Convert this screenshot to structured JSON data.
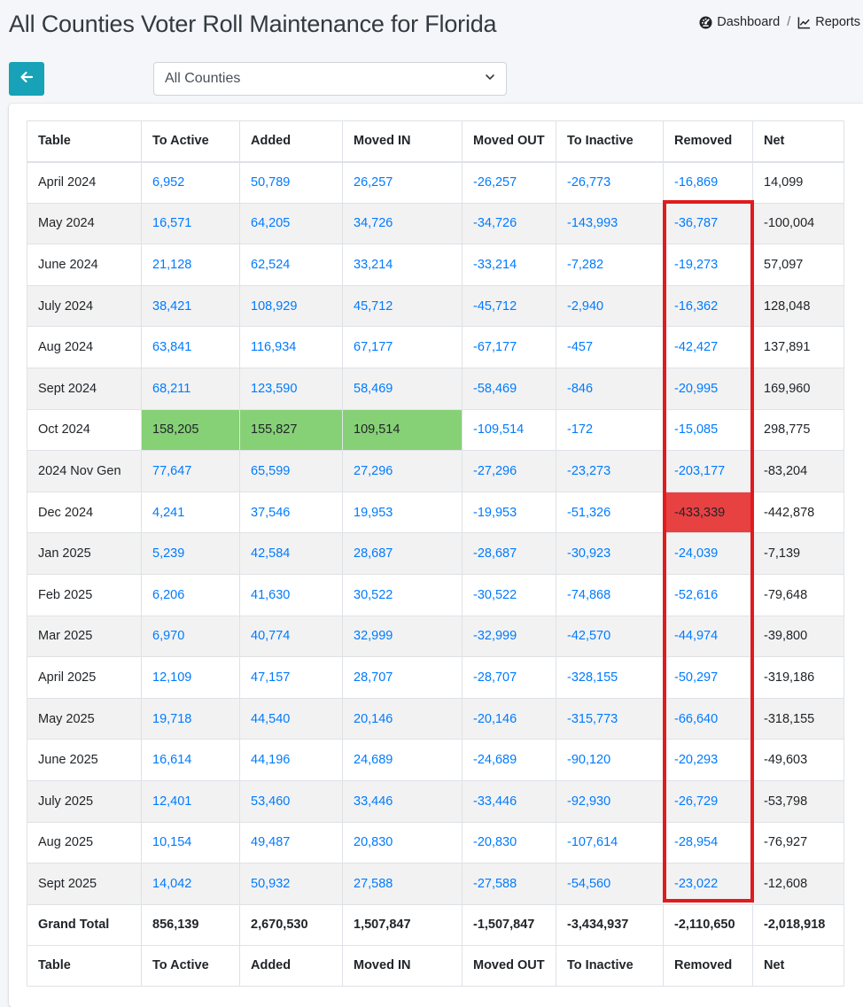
{
  "header": {
    "title": "All Counties Voter Roll Maintenance for Florida",
    "breadcrumb": {
      "dashboard": "Dashboard",
      "separator": "/",
      "reports": "Reports"
    }
  },
  "toolbar": {
    "back_icon": "arrow-left-icon",
    "county_select": {
      "selected": "All Counties"
    }
  },
  "colors": {
    "accent": "#17a2b8",
    "link": "#007bff",
    "highlight_green": "#86d175",
    "highlight_red": "#e84142",
    "annotation_box": "#e11b1d"
  },
  "table": {
    "columns": [
      "Table",
      "To Active",
      "Added",
      "Moved IN",
      "Moved OUT",
      "To Inactive",
      "Removed",
      "Net"
    ],
    "rows": [
      [
        "April 2024",
        "6,952",
        "50,789",
        "26,257",
        "-26,257",
        "-26,773",
        "-16,869",
        "14,099"
      ],
      [
        "May 2024",
        "16,571",
        "64,205",
        "34,726",
        "-34,726",
        "-143,993",
        "-36,787",
        "-100,004"
      ],
      [
        "June 2024",
        "21,128",
        "62,524",
        "33,214",
        "-33,214",
        "-7,282",
        "-19,273",
        "57,097"
      ],
      [
        "July 2024",
        "38,421",
        "108,929",
        "45,712",
        "-45,712",
        "-2,940",
        "-16,362",
        "128,048"
      ],
      [
        "Aug 2024",
        "63,841",
        "116,934",
        "67,177",
        "-67,177",
        "-457",
        "-42,427",
        "137,891"
      ],
      [
        "Sept 2024",
        "68,211",
        "123,590",
        "58,469",
        "-58,469",
        "-846",
        "-20,995",
        "169,960"
      ],
      [
        "Oct 2024",
        "158,205",
        "155,827",
        "109,514",
        "-109,514",
        "-172",
        "-15,085",
        "298,775"
      ],
      [
        "2024 Nov Gen",
        "77,647",
        "65,599",
        "27,296",
        "-27,296",
        "-23,273",
        "-203,177",
        "-83,204"
      ],
      [
        "Dec 2024",
        "4,241",
        "37,546",
        "19,953",
        "-19,953",
        "-51,326",
        "-433,339",
        "-442,878"
      ],
      [
        "Jan 2025",
        "5,239",
        "42,584",
        "28,687",
        "-28,687",
        "-30,923",
        "-24,039",
        "-7,139"
      ],
      [
        "Feb 2025",
        "6,206",
        "41,630",
        "30,522",
        "-30,522",
        "-74,868",
        "-52,616",
        "-79,648"
      ],
      [
        "Mar 2025",
        "6,970",
        "40,774",
        "32,999",
        "-32,999",
        "-42,570",
        "-44,974",
        "-39,800"
      ],
      [
        "April 2025",
        "12,109",
        "47,157",
        "28,707",
        "-28,707",
        "-328,155",
        "-50,297",
        "-319,186"
      ],
      [
        "May 2025",
        "19,718",
        "44,540",
        "20,146",
        "-20,146",
        "-315,773",
        "-66,640",
        "-318,155"
      ],
      [
        "June 2025",
        "16,614",
        "44,196",
        "24,689",
        "-24,689",
        "-90,120",
        "-20,293",
        "-49,603"
      ],
      [
        "July 2025",
        "12,401",
        "53,460",
        "33,446",
        "-33,446",
        "-92,930",
        "-26,729",
        "-53,798"
      ],
      [
        "Aug 2025",
        "10,154",
        "49,487",
        "20,830",
        "-20,830",
        "-107,614",
        "-28,954",
        "-76,927"
      ],
      [
        "Sept 2025",
        "14,042",
        "50,932",
        "27,588",
        "-27,588",
        "-54,560",
        "-23,022",
        "-12,608"
      ]
    ],
    "grand_total": [
      "Grand Total",
      "856,139",
      "2,670,530",
      "1,507,847",
      "-1,507,847",
      "-3,434,937",
      "-2,110,650",
      "-2,018,918"
    ],
    "highlights": {
      "green": [
        [
          6,
          1
        ],
        [
          6,
          2
        ],
        [
          6,
          3
        ]
      ],
      "red": [
        [
          8,
          6
        ]
      ]
    }
  }
}
